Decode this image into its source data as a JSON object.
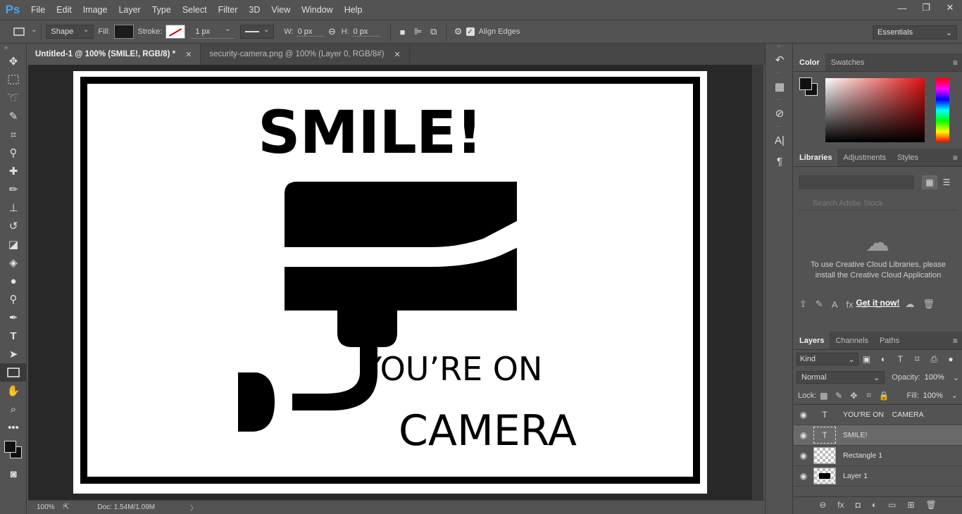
{
  "app": {
    "logo": "Ps"
  },
  "menu": [
    "File",
    "Edit",
    "Image",
    "Layer",
    "Type",
    "Select",
    "Filter",
    "3D",
    "View",
    "Window",
    "Help"
  ],
  "window_controls": {
    "minimize": "—",
    "restore": "❐",
    "close": "✕"
  },
  "options": {
    "shape_mode": "Shape",
    "fill_label": "Fill:",
    "stroke_label": "Stroke:",
    "stroke_size": "1 px",
    "w_label": "W:",
    "w_value": "0 px",
    "h_label": "H:",
    "h_value": "0 px",
    "align_edges": "Align Edges",
    "workspace": "Essentials"
  },
  "tabs": [
    {
      "label": "Untitled-1 @ 100% (SMILE!, RGB/8) *",
      "close": "✕"
    },
    {
      "label": "security-camera.png @ 100% (Layer 0, RGB/8#)",
      "close": "✕"
    }
  ],
  "canvas": {
    "title": "SMILE!",
    "line1": "YOU’RE ON",
    "line2": "CAMERA",
    "paper_color": "#ffffff",
    "ink_color": "#000000"
  },
  "status": {
    "zoom": "100%",
    "doc": "Doc: 1.54M/1.09M",
    "arrow": "〉"
  },
  "panels": {
    "color": {
      "tabs": [
        "Color",
        "Swatches"
      ]
    },
    "libraries": {
      "tabs": [
        "Libraries",
        "Adjustments",
        "Styles"
      ],
      "search_placeholder": "Search Adobe Stock",
      "message": "To use Creative Cloud Libraries, please install the Creative Cloud Application",
      "link": "Get it now!"
    },
    "layers": {
      "tabs": [
        "Layers",
        "Channels",
        "Paths"
      ],
      "kind": "Kind",
      "blend": "Normal",
      "opacity_label": "Opacity:",
      "opacity": "100%",
      "lock_label": "Lock:",
      "fill_label": "Fill:",
      "fill": "100%",
      "items": [
        {
          "name": "YOU'RE ON    CAMERA",
          "type": "text"
        },
        {
          "name": "SMILE!",
          "type": "text",
          "selected": true
        },
        {
          "name": "Rectangle 1",
          "type": "shape"
        },
        {
          "name": "Layer 1",
          "type": "image"
        }
      ]
    }
  }
}
